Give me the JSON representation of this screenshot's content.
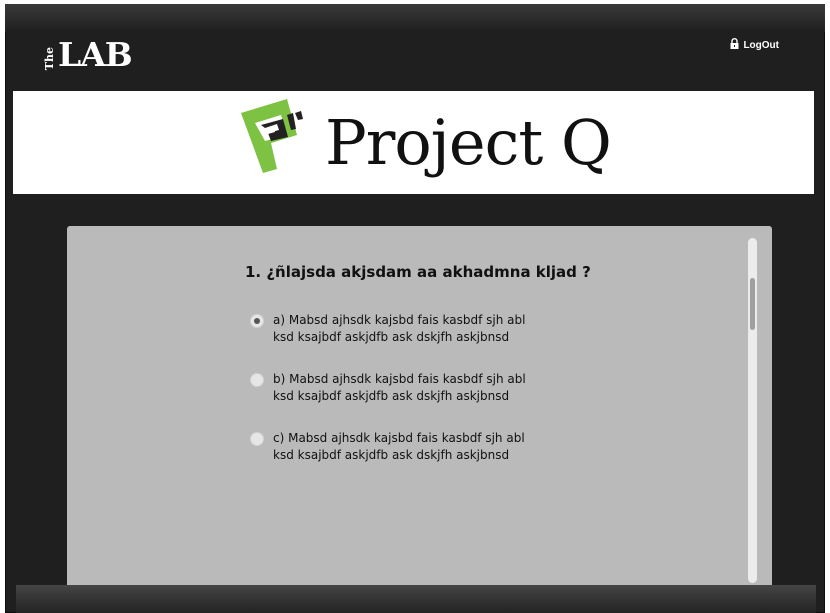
{
  "header": {
    "logo_small": "The",
    "logo_word": "LAB",
    "logout_label": "LogOut",
    "logout_icon": "lock-icon"
  },
  "banner": {
    "title": "Project Q",
    "logo_icon": "project-q-logo",
    "accent_green": "#7dc242"
  },
  "quiz": {
    "question": "1. ¿ñlajsda  akjsdam aa akhadmna kljad ?",
    "options": [
      {
        "text": "a) Mabsd ajhsdk kajsbd fais  kasbdf sjh abl\nksd ksajbdf askjdfb ask dskjfh askjbnsd",
        "selected": true
      },
      {
        "text": "b) Mabsd ajhsdk kajsbd fais  kasbdf sjh abl\nksd ksajbdf askjdfb ask dskjfh askjbnsd",
        "selected": false
      },
      {
        "text": "c) Mabsd ajhsdk kajsbd fais  kasbdf sjh abl\nksd ksajbdf askjdfb ask dskjfh askjbnsd",
        "selected": false
      }
    ]
  }
}
